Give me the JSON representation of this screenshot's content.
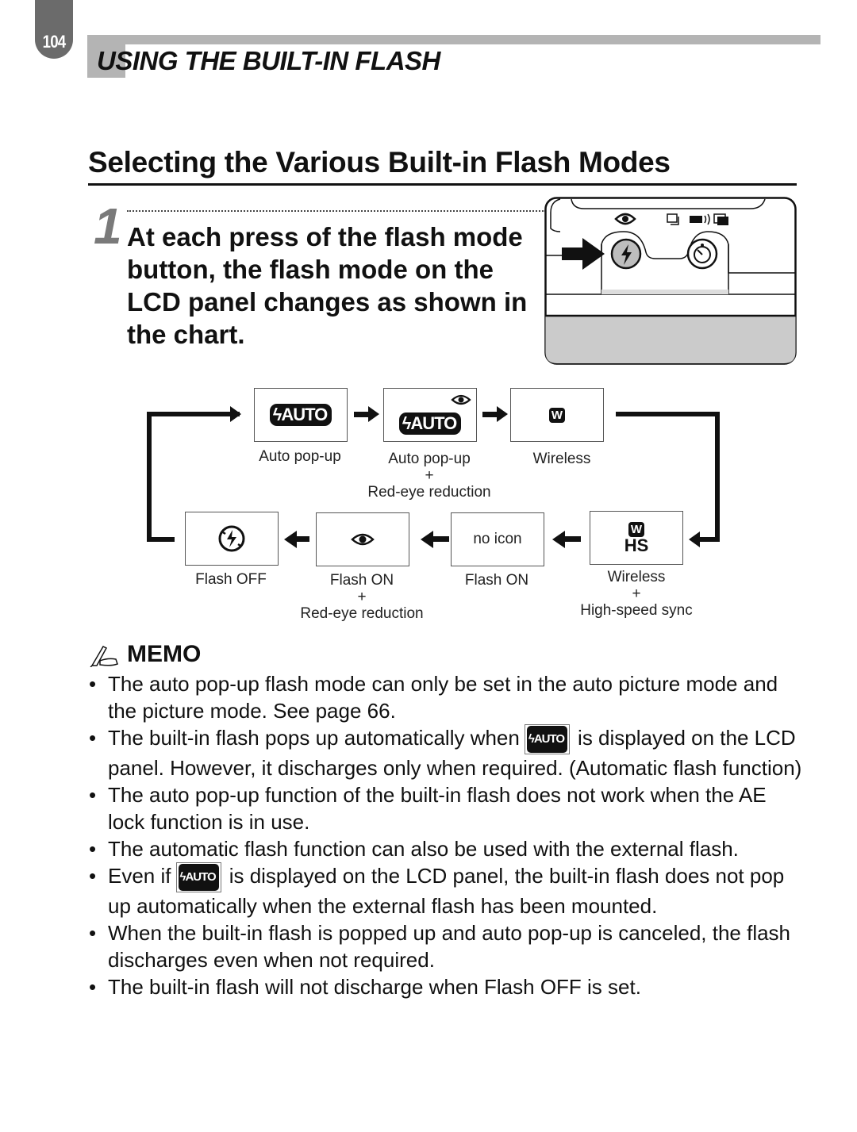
{
  "header": {
    "page_number": "104",
    "chapter_title": "USING THE BUILT-IN FLASH"
  },
  "section": {
    "title": "Selecting the Various Built-in Flash Modes"
  },
  "step": {
    "number": "1",
    "text": "At each press of the flash mode button, the flash mode on the LCD panel changes as shown in the chart."
  },
  "flow_chart": {
    "badge_auto": "AUTO",
    "badge_w": "W",
    "badge_hs": "HS",
    "modes": [
      {
        "id": "auto-popup",
        "icon": "flash-auto-icon",
        "label_lines": [
          "Auto pop-up"
        ]
      },
      {
        "id": "auto-popup-redeye",
        "icon": "flash-auto-redeye-icon",
        "label_lines": [
          "Auto pop-up",
          "+",
          "Red-eye reduction"
        ]
      },
      {
        "id": "wireless",
        "icon": "wireless-icon",
        "label_lines": [
          "Wireless"
        ]
      },
      {
        "id": "wireless-hs",
        "icon": "wireless-hs-icon",
        "label_lines": [
          "Wireless",
          "+",
          "High-speed sync"
        ]
      },
      {
        "id": "flash-on",
        "icon": "none",
        "box_text": "no icon",
        "label_lines": [
          "Flash ON"
        ]
      },
      {
        "id": "flash-on-redeye",
        "icon": "redeye-icon",
        "label_lines": [
          "Flash ON",
          "+",
          "Red-eye reduction"
        ]
      },
      {
        "id": "flash-off",
        "icon": "flash-off-icon",
        "label_lines": [
          "Flash OFF"
        ]
      }
    ]
  },
  "memo": {
    "title": "MEMO",
    "bullet": "•",
    "inline_badge": "AUTO",
    "items": [
      {
        "text": "The auto pop-up flash mode can only be set in the auto picture mode and the picture mode. See page 66."
      },
      {
        "before": "The built-in flash pops up automatically when",
        "after": "is displayed on the LCD panel. However, it discharges only when required. (Automatic flash function)"
      },
      {
        "text": "The auto pop-up function of the built-in flash does not work when the AE lock function is in use."
      },
      {
        "text": "The automatic flash function can also be used with the external flash."
      },
      {
        "before": "Even if",
        "after": "is displayed on the LCD panel, the built-in flash does not pop up automatically when the external flash has been mounted."
      },
      {
        "text": "When the built-in flash is popped up and auto pop-up is canceled, the flash discharges even when not required."
      },
      {
        "text": "The built-in flash will not discharge when Flash OFF is set."
      }
    ]
  }
}
